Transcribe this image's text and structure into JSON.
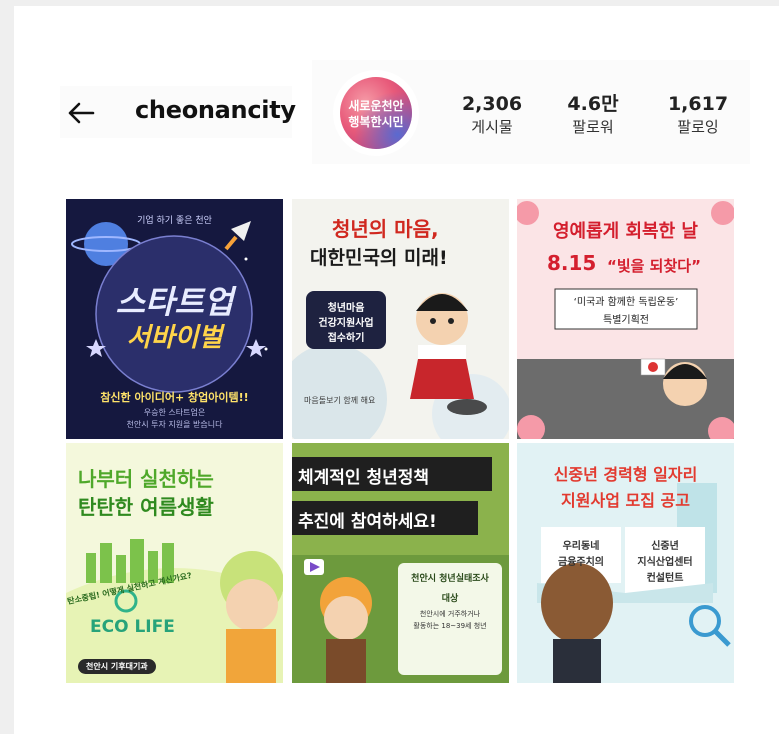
{
  "profile": {
    "username": "cheonancity",
    "stats": [
      {
        "value": "2,306",
        "label": "게시물"
      },
      {
        "value": "4.6만",
        "label": "팔로워"
      },
      {
        "value": "1,617",
        "label": "팔로잉"
      }
    ],
    "avatar_text": [
      "새로운천안",
      "행복한시민"
    ]
  },
  "posts": [
    {
      "top": "기업 하기 좋은 천안",
      "title1": "스타트업",
      "title2": "서바이벌",
      "sub": "참신한 아이디어+ 창업아이템!!",
      "small": "우승한 스타트업은",
      "small2": "천안시 투자 지원을 받습니다"
    },
    {
      "title1": "청년의 마음,",
      "title2": "대한민국의 미래!",
      "box": [
        "청년마음",
        "건강지원사업",
        "접수하기"
      ],
      "note": "마음돌보기 함께 해요"
    },
    {
      "title": "영예롭게 회복한 날",
      "date": "8.15",
      "quote": "“빛을 되찾다”",
      "box1": "‘미국과 함께한 독립운동’",
      "box2": "특별기획전"
    },
    {
      "title1": "나부터 실천하는",
      "title2": "탄탄한 여름생활",
      "arc": "탄소중립! 어떻게 실천하고 계신가요?",
      "eco": "ECO LIFE",
      "dept": "천안시 기후대기과"
    },
    {
      "title1": "체계적인 청년정책",
      "title2": "추진에 참여하세요!",
      "panel": "천안시 청년실태조사",
      "target": "대상",
      "desc1": "천안시에 거주하거나",
      "desc2": "활동하는 18~39세 청년"
    },
    {
      "title1": "신중년 경력형 일자리",
      "title2": "지원사업 모집 공고",
      "left1": "우리동네",
      "left2": "금융주치의",
      "right1": "신중년",
      "right2": "지식산업센터",
      "right3": "컨설턴트"
    }
  ],
  "colors": {
    "background": "#efefef",
    "card": "#ffffff",
    "text": "#111111"
  }
}
